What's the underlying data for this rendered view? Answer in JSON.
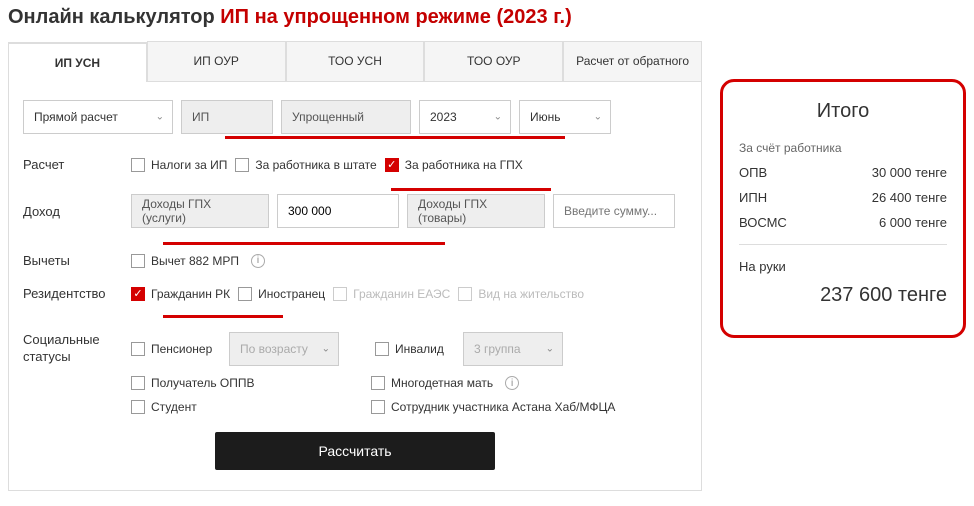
{
  "title": {
    "prefix": "Онлайн калькулятор ",
    "highlight": "ИП на упрощенном режиме (2023 г.)"
  },
  "tabs": [
    "ИП УСН",
    "ИП ОУР",
    "ТОО УСН",
    "ТОО ОУР",
    "Расчет от обратного"
  ],
  "selectors": {
    "mode": "Прямой расчет",
    "entity": "ИП",
    "regime": "Упрощенный",
    "year": "2023",
    "month": "Июнь"
  },
  "labels": {
    "raschet": "Расчет",
    "dohod": "Доход",
    "vychety": "Вычеты",
    "residentstvo": "Резидентство",
    "social": "Социальные статусы"
  },
  "calc_checks": {
    "nalogi_ip": "Налоги за ИП",
    "za_shtat": "За работника в штате",
    "za_gpx": "За работника на ГПХ"
  },
  "income": {
    "services_label": "Доходы ГПХ (услуги)",
    "services_value": "300 000",
    "goods_label": "Доходы ГПХ (товары)",
    "goods_placeholder": "Введите сумму..."
  },
  "deduction": {
    "mrp": "Вычет 882 МРП"
  },
  "residency": {
    "rk": "Гражданин РК",
    "foreign": "Иностранец",
    "eaes": "Гражданин ЕАЭС",
    "vnj": "Вид на жительство"
  },
  "social": {
    "pensioner": "Пенсионер",
    "pensioner_sel": "По возрасту",
    "invalid": "Инвалид",
    "invalid_sel": "3 группа",
    "oppv": "Получатель ОППВ",
    "multichild": "Многодетная мать",
    "student": "Студент",
    "astanahub": "Сотрудник участника Астана Хаб/МФЦА"
  },
  "button": "Рассчитать",
  "results": {
    "title": "Итого",
    "subtitle": "За счёт работника",
    "rows": [
      {
        "label": "ОПВ",
        "value": "30 000 тенге"
      },
      {
        "label": "ИПН",
        "value": "26 400 тенге"
      },
      {
        "label": "ВОСМС",
        "value": "6 000 тенге"
      }
    ],
    "net_label": "На руки",
    "net_value": "237 600 тенге"
  }
}
